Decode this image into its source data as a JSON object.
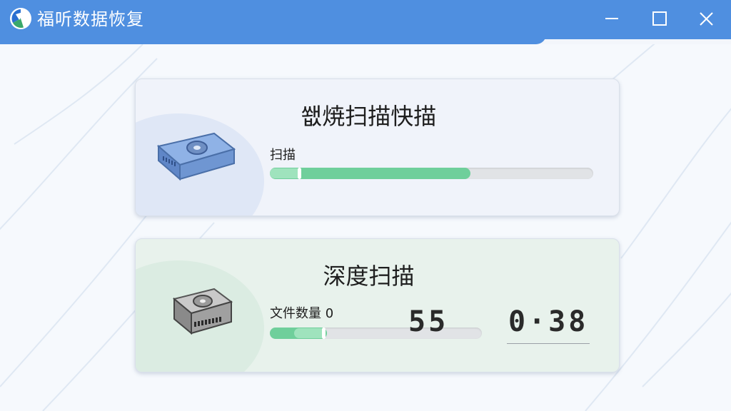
{
  "app": {
    "title": "福听数据恢复"
  },
  "quick_scan": {
    "title": "쐢焼扫描快描",
    "label": "扫描",
    "progress": 0.62,
    "accent": "#6fcf9b"
  },
  "deep_scan": {
    "title": "深度扫描",
    "label": "文件数量 0",
    "counter": "55",
    "timer": "0·38",
    "progress": 0.27,
    "accent": "#6fcf9b"
  },
  "colors": {
    "titlebar": "#4f8fe0",
    "card_quick_bg": "#f0f3fa",
    "card_deep_bg": "#e8f2ec"
  },
  "icons": {
    "logo": "app-logo-icon",
    "minimize": "minimize-icon",
    "maximize": "maximize-icon",
    "close": "close-icon",
    "quick_drive": "hard-drive-blue-icon",
    "deep_drive": "hard-drive-gray-icon"
  }
}
